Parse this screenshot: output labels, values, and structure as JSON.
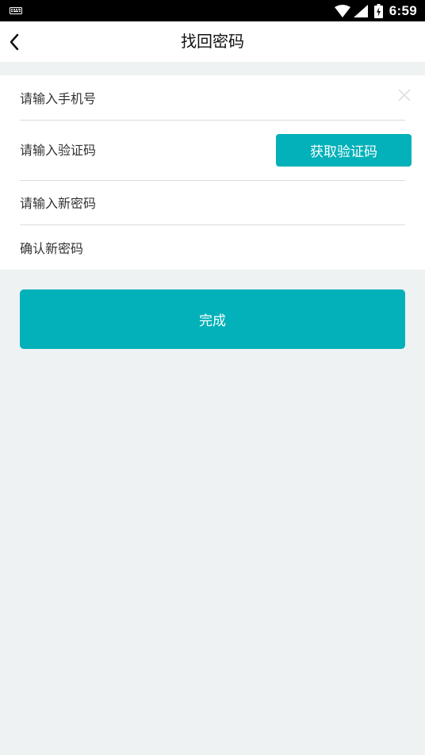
{
  "status_bar": {
    "time": "6:59",
    "icons": [
      "keyboard-icon",
      "wifi-icon",
      "signal-icon",
      "battery-icon"
    ]
  },
  "app_bar": {
    "title": "找回密码",
    "back_icon": "chevron-left-icon"
  },
  "form": {
    "phone": {
      "placeholder": "请输入手机号",
      "value": ""
    },
    "code": {
      "placeholder": "请输入验证码",
      "value": "",
      "button_label": "获取验证码"
    },
    "new_password": {
      "placeholder": "请输入新密码",
      "value": ""
    },
    "confirm_password": {
      "placeholder": "确认新密码",
      "value": ""
    },
    "clear_icon": "close-icon"
  },
  "actions": {
    "done_label": "完成"
  },
  "colors": {
    "accent": "#02b1b9",
    "background": "#eff2f3",
    "surface": "#ffffff",
    "status_bar": "#000000"
  }
}
